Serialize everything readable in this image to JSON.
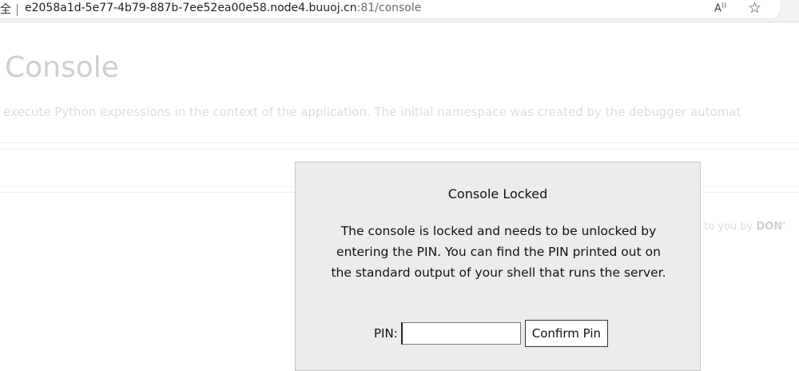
{
  "browser": {
    "security_label": "全",
    "url_host": "e2058a1d-5e77-4b79-887b-7ee52ea00e58.node4.buuoj.cn",
    "url_rest": ":81/console",
    "read_aloud_icon": "read-aloud-icon",
    "favorite_icon": "star-outline-icon"
  },
  "page": {
    "title": "Console",
    "description": "execute Python expressions in the context of the application. The initial namespace was created by the debugger automat",
    "side_text_prefix": "t to you by ",
    "side_text_bold": "DON'"
  },
  "modal": {
    "title": "Console Locked",
    "message": "The console is locked and needs to be unlocked by entering the PIN. You can find the PIN printed out on the standard output of your shell that runs the server.",
    "pin_label": "PIN:",
    "pin_value": "",
    "confirm_label": "Confirm Pin"
  },
  "colors": {
    "modal_bg": "#ececec",
    "faded_text": "#cfcfcf"
  }
}
